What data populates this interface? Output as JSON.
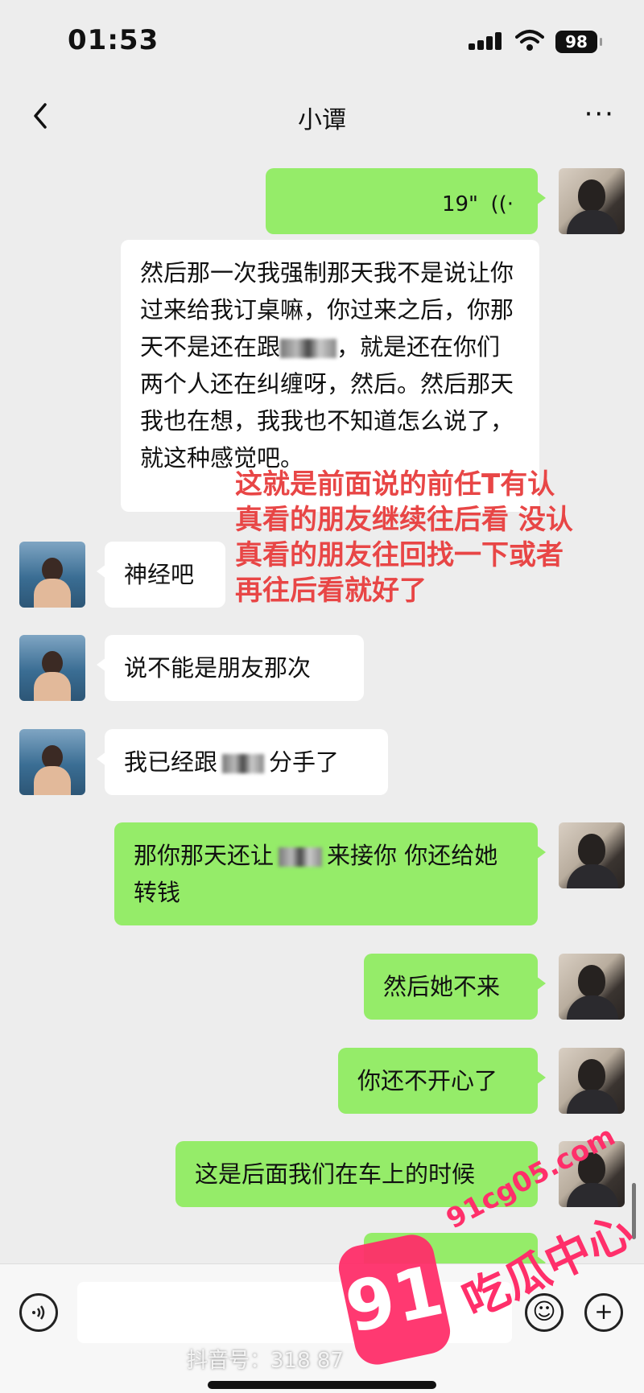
{
  "status": {
    "time": "01:53",
    "battery": "98"
  },
  "nav": {
    "title": "小谭",
    "more": "···"
  },
  "messages": {
    "m1_duration": "19\"",
    "m1_icon": "((·",
    "m2_a": "然后那一次我强制那天我不是说让你过来给我订桌嘛，你过来之后，你那天不是还在跟",
    "m2_b": "，就是还在你们两个人还在纠缠呀，然后。然后那天我也在想，我我也不知道怎么说了，就这种感觉吧。",
    "m3": "神经吧",
    "m4": "说不能是朋友那次",
    "m5_a": "我已经跟",
    "m5_b": "分手了",
    "m6_a": "那你那天还让",
    "m6_b": "来接你 你还给她转钱",
    "m7": "然后她不来",
    "m8": "你还不开心了",
    "m9": "这是后面我们在车上的时候"
  },
  "annotation": "这就是前面说的前任T有认真看的朋友继续往后看 没认真看的朋友往回找一下或者再往后看就好了",
  "watermark": {
    "number": "91",
    "text": "吃瓜中心",
    "url": "91cg05.com",
    "tiktok": "抖音号：318  87"
  },
  "colors": {
    "green": "#95ec69",
    "bg": "#ededed",
    "annot": "#e84646",
    "wm": "#ff2f6a"
  }
}
